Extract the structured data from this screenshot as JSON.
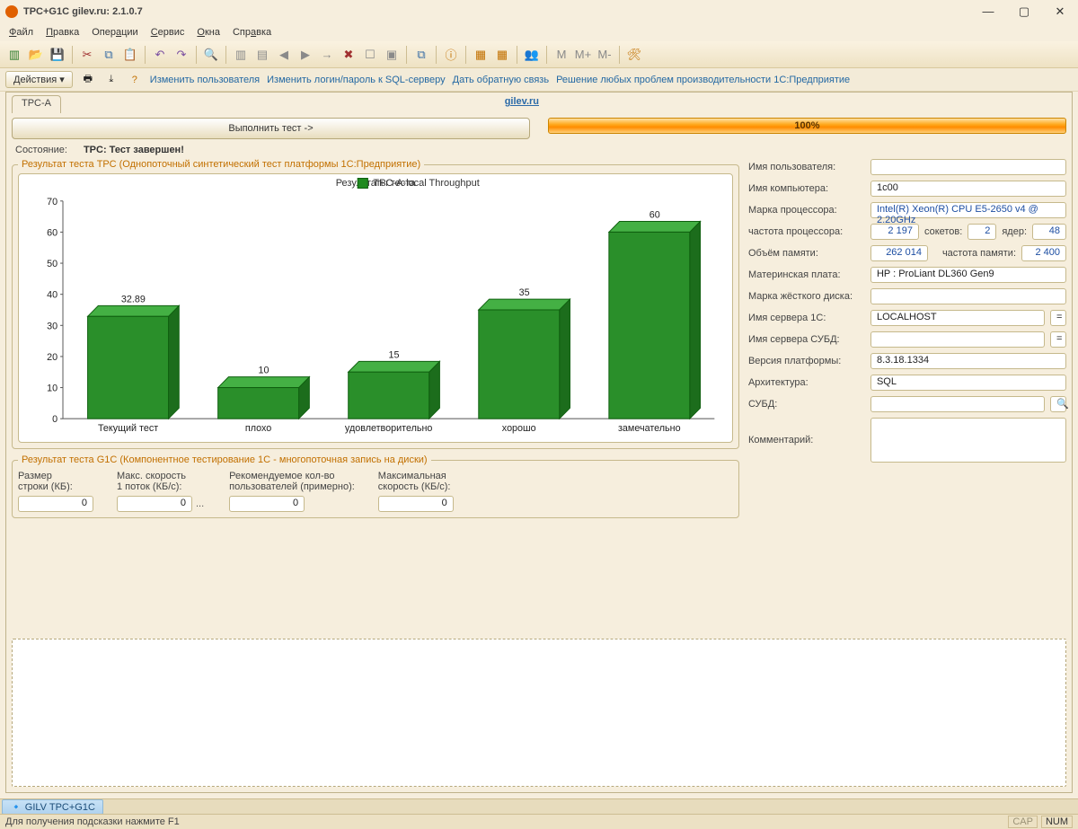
{
  "window": {
    "title": "TPC+G1C gilev.ru: 2.1.0.7"
  },
  "menu": {
    "items": [
      "Файл",
      "Правка",
      "Операции",
      "Сервис",
      "Окна",
      "Справка"
    ]
  },
  "actions": {
    "dropdown": "Действия ▾",
    "links": [
      "Изменить пользователя",
      "Изменить логин/пароль к SQL-серверу",
      "Дать обратную связь",
      "Решение любых проблем производительности 1С:Предприятие"
    ]
  },
  "tab": "TPC-A",
  "siteLink": "gilev.ru",
  "run": {
    "button": "Выполнить тест ->",
    "progress": "100%"
  },
  "status": {
    "label": "Состояние:",
    "value": "TPC: Тест завершен!"
  },
  "tpc": {
    "legend": "Результат теста ТРС (Однопоточный синтетический тест платформы 1С:Предприятие)"
  },
  "chart_data": {
    "type": "bar",
    "title": "Результаты теста",
    "series_name": "TPC-A-local Throughput",
    "categories": [
      "Текущий тест",
      "плохо",
      "удовлетворительно",
      "хорошо",
      "замечательно"
    ],
    "values": [
      32.89,
      10,
      15,
      35,
      60
    ],
    "ylim": [
      0,
      70
    ],
    "ytick": 10,
    "xlabel": "",
    "ylabel": ""
  },
  "g1c": {
    "legend": "Результат теста G1C (Компонентное тестирование 1С - многопоточная запись на диски)",
    "cols": [
      {
        "hdr": "Размер\nстроки (КБ):",
        "val": "0"
      },
      {
        "hdr": "Макс. скорость\n1 поток (КБ/с):",
        "val": "0",
        "ell": true
      },
      {
        "hdr": "Рекомендуемое кол-во\nпользователей (примерно):",
        "val": "0"
      },
      {
        "hdr": "Максимальная\nскорость (КБ/с):",
        "val": "0"
      }
    ]
  },
  "info": {
    "user_label": "Имя пользователя:",
    "user": "",
    "host_label": "Имя компьютера:",
    "host": "1c00",
    "cpu_label": "Марка процессора:",
    "cpu": "Intel(R) Xeon(R) CPU E5-2650 v4 @ 2.20GHz",
    "cpu_freq_label": "частота процессора:",
    "cpu_freq": "2 197",
    "sockets_label": "сокетов:",
    "sockets": "2",
    "cores_label": "ядер:",
    "cores": "48",
    "ram_label": "Объём памяти:",
    "ram": "262 014",
    "ram_freq_label": "частота памяти:",
    "ram_freq": "2 400",
    "mb_label": "Материнская плата:",
    "mb": "HP : ProLiant DL360 Gen9",
    "hdd_label": "Марка жёсткого диска:",
    "hdd": "",
    "srv1c_label": "Имя сервера 1С:",
    "srv1c": "LOCALHOST",
    "srvdb_label": "Имя сервера СУБД:",
    "srvdb": "",
    "plat_label": "Версия платформы:",
    "plat": "8.3.18.1334",
    "arch_label": "Архитектура:",
    "arch": "SQL",
    "dbms_label": "СУБД:",
    "dbms": "",
    "comment_label": "Комментарий:"
  },
  "task": "GILV TPC+G1C",
  "statusbar": {
    "hint": "Для получения подсказки нажмите F1",
    "cap": "CAP",
    "num": "NUM"
  }
}
